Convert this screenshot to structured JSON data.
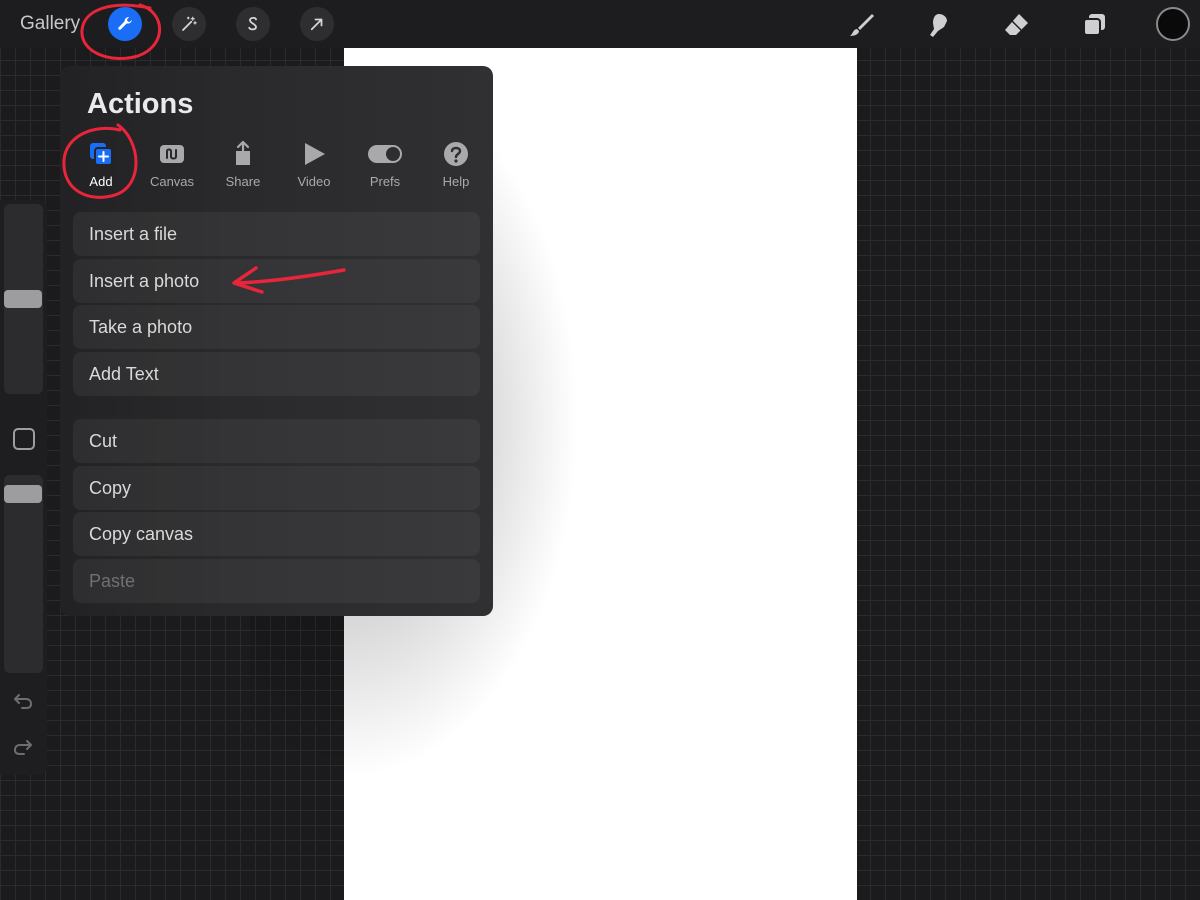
{
  "topbar": {
    "gallery_label": "Gallery",
    "left_tools": [
      "wrench-icon",
      "magic-wand-icon",
      "selection-s-icon",
      "transform-arrow-icon"
    ],
    "right_tools": [
      "brush-icon",
      "smudge-icon",
      "eraser-icon",
      "layers-icon"
    ],
    "active_color": "#0a0a0a"
  },
  "actions_panel": {
    "title": "Actions",
    "tabs": [
      {
        "label": "Add",
        "icon": "add-icon",
        "active": true
      },
      {
        "label": "Canvas",
        "icon": "canvas-icon",
        "active": false
      },
      {
        "label": "Share",
        "icon": "share-icon",
        "active": false
      },
      {
        "label": "Video",
        "icon": "play-icon",
        "active": false
      },
      {
        "label": "Prefs",
        "icon": "toggle-icon",
        "active": false
      },
      {
        "label": "Help",
        "icon": "help-icon",
        "active": false
      }
    ],
    "items": [
      {
        "label": "Insert a file"
      },
      {
        "label": "Insert a photo"
      },
      {
        "label": "Take a photo"
      },
      {
        "label": "Add Text"
      },
      {
        "label": "Cut"
      },
      {
        "label": "Copy"
      },
      {
        "label": "Copy canvas"
      },
      {
        "label": "Paste",
        "disabled": true
      }
    ]
  },
  "sidebar": {
    "tools": [
      "brush-size-slider",
      "modify-button",
      "opacity-slider",
      "undo-icon",
      "redo-icon"
    ]
  },
  "colors": {
    "accent": "#1a6ef5",
    "annotation": "#e8253a"
  }
}
